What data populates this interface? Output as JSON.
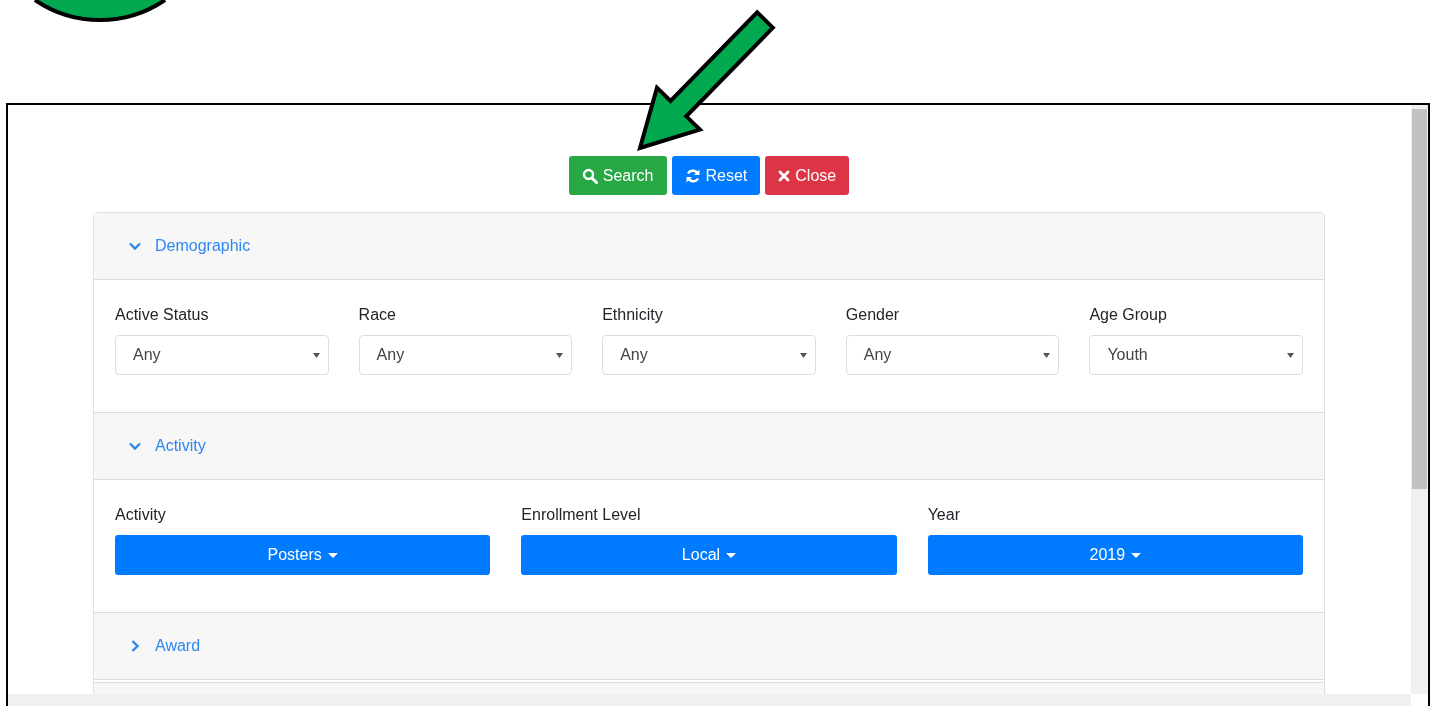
{
  "buttons": [
    {
      "label": "Search",
      "kind": "search"
    },
    {
      "label": "Reset",
      "kind": "reset"
    },
    {
      "label": "Close",
      "kind": "close"
    }
  ],
  "sections": [
    {
      "title": "Demographic",
      "expanded": true,
      "kind": "selects",
      "fields": [
        {
          "label": "Active Status",
          "value": "Any"
        },
        {
          "label": "Race",
          "value": "Any"
        },
        {
          "label": "Ethnicity",
          "value": "Any"
        },
        {
          "label": "Gender",
          "value": "Any"
        },
        {
          "label": "Age Group",
          "value": "Youth"
        }
      ]
    },
    {
      "title": "Activity",
      "expanded": true,
      "kind": "dropdowns",
      "fields": [
        {
          "label": "Activity",
          "value": "Posters"
        },
        {
          "label": "Enrollment Level",
          "value": "Local"
        },
        {
          "label": "Year",
          "value": "2019"
        }
      ]
    },
    {
      "title": "Award",
      "expanded": false
    }
  ]
}
